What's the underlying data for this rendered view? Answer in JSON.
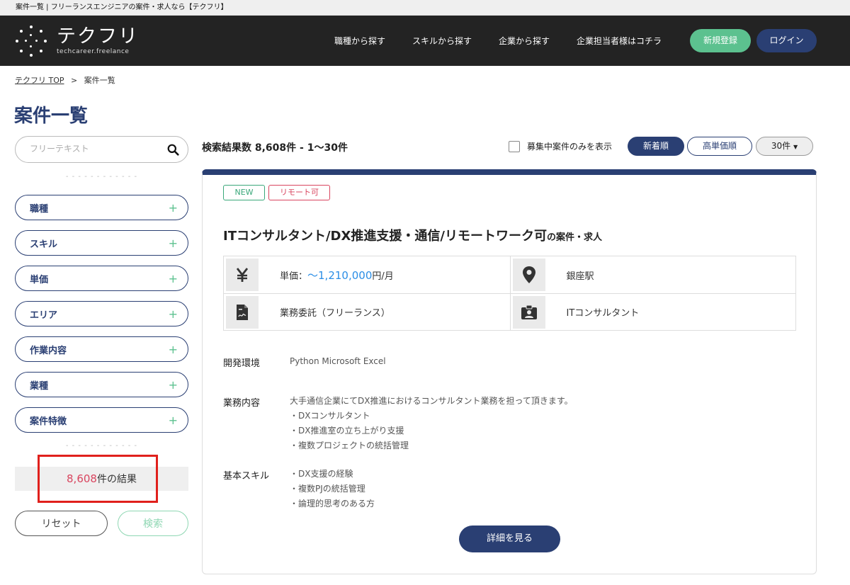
{
  "tab": {
    "title": "案件一覧 | フリーランスエンジニアの案件・求人なら【テクフリ】"
  },
  "header": {
    "logo_title": "テクフリ",
    "logo_sub": "techcareer.freelance",
    "nav": [
      "職種から探す",
      "スキルから探す",
      "企業から探す",
      "企業担当者様はコチラ"
    ],
    "register_label": "新規登録",
    "login_label": "ログイン"
  },
  "breadcrumb": {
    "home": "テクフリ TOP",
    "separator": ">",
    "current": "案件一覧"
  },
  "page_title": "案件一覧",
  "sidebar": {
    "search_placeholder": "フリーテキスト",
    "dashes": "- - - - - - - - - - - -",
    "filters": [
      "職種",
      "スキル",
      "単価",
      "エリア",
      "作業内容",
      "業種",
      "案件特徴"
    ],
    "plus": "+",
    "result_count": "8,608",
    "result_suffix": "件の結果",
    "reset_label": "リセット",
    "search_label": "検索"
  },
  "toolbar": {
    "result_text": "検索結果数 8,608件 - 1〜30件",
    "only_open_label": "募集中案件のみを表示",
    "sort_new": "新着順",
    "sort_price": "高単価順",
    "per_page": "30件"
  },
  "job": {
    "tags": [
      "NEW",
      "リモート可"
    ],
    "title": "ITコンサルタント/DX推進支援・通信/リモートワーク可",
    "title_suffix": "の案件・求人",
    "price_prefix": "単価：",
    "price": "〜1,210,000",
    "price_unit": "円/月",
    "station": "銀座駅",
    "contract": "業務委託（フリーランス）",
    "role": "ITコンサルタント",
    "env_label": "開発環境",
    "env_value": "Python  Microsoft Excel",
    "work_label": "業務内容",
    "work_lines": [
      "大手通信企業にてDX推進におけるコンサルタント業務を担って頂きます。",
      "・DXコンサルタント",
      "・DX推進室の立ち上がり支援",
      "・複数プロジェクトの統括管理"
    ],
    "skill_label": "基本スキル",
    "skill_lines": [
      "・DX支援の経験",
      "・複数PJの統括管理",
      "・論理的思考のある方"
    ],
    "detail_label": "詳細を見る"
  },
  "colors": {
    "navy": "#2a3f73",
    "green": "#5cc18f",
    "red": "#d9455f",
    "blue": "#2b8ee6",
    "highlight": "#e0201c"
  },
  "icons": [
    "yen-icon",
    "location-pin-icon",
    "document-icon",
    "id-badge-icon",
    "search-icon"
  ]
}
